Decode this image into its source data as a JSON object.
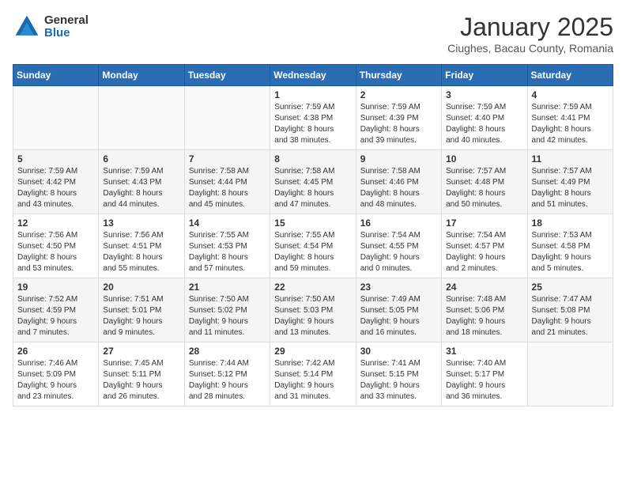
{
  "logo": {
    "general": "General",
    "blue": "Blue"
  },
  "title": "January 2025",
  "location": "Ciughes, Bacau County, Romania",
  "days_of_week": [
    "Sunday",
    "Monday",
    "Tuesday",
    "Wednesday",
    "Thursday",
    "Friday",
    "Saturday"
  ],
  "weeks": [
    [
      {
        "day": "",
        "info": ""
      },
      {
        "day": "",
        "info": ""
      },
      {
        "day": "",
        "info": ""
      },
      {
        "day": "1",
        "info": "Sunrise: 7:59 AM\nSunset: 4:38 PM\nDaylight: 8 hours\nand 38 minutes."
      },
      {
        "day": "2",
        "info": "Sunrise: 7:59 AM\nSunset: 4:39 PM\nDaylight: 8 hours\nand 39 minutes."
      },
      {
        "day": "3",
        "info": "Sunrise: 7:59 AM\nSunset: 4:40 PM\nDaylight: 8 hours\nand 40 minutes."
      },
      {
        "day": "4",
        "info": "Sunrise: 7:59 AM\nSunset: 4:41 PM\nDaylight: 8 hours\nand 42 minutes."
      }
    ],
    [
      {
        "day": "5",
        "info": "Sunrise: 7:59 AM\nSunset: 4:42 PM\nDaylight: 8 hours\nand 43 minutes."
      },
      {
        "day": "6",
        "info": "Sunrise: 7:59 AM\nSunset: 4:43 PM\nDaylight: 8 hours\nand 44 minutes."
      },
      {
        "day": "7",
        "info": "Sunrise: 7:58 AM\nSunset: 4:44 PM\nDaylight: 8 hours\nand 45 minutes."
      },
      {
        "day": "8",
        "info": "Sunrise: 7:58 AM\nSunset: 4:45 PM\nDaylight: 8 hours\nand 47 minutes."
      },
      {
        "day": "9",
        "info": "Sunrise: 7:58 AM\nSunset: 4:46 PM\nDaylight: 8 hours\nand 48 minutes."
      },
      {
        "day": "10",
        "info": "Sunrise: 7:57 AM\nSunset: 4:48 PM\nDaylight: 8 hours\nand 50 minutes."
      },
      {
        "day": "11",
        "info": "Sunrise: 7:57 AM\nSunset: 4:49 PM\nDaylight: 8 hours\nand 51 minutes."
      }
    ],
    [
      {
        "day": "12",
        "info": "Sunrise: 7:56 AM\nSunset: 4:50 PM\nDaylight: 8 hours\nand 53 minutes."
      },
      {
        "day": "13",
        "info": "Sunrise: 7:56 AM\nSunset: 4:51 PM\nDaylight: 8 hours\nand 55 minutes."
      },
      {
        "day": "14",
        "info": "Sunrise: 7:55 AM\nSunset: 4:53 PM\nDaylight: 8 hours\nand 57 minutes."
      },
      {
        "day": "15",
        "info": "Sunrise: 7:55 AM\nSunset: 4:54 PM\nDaylight: 8 hours\nand 59 minutes."
      },
      {
        "day": "16",
        "info": "Sunrise: 7:54 AM\nSunset: 4:55 PM\nDaylight: 9 hours\nand 0 minutes."
      },
      {
        "day": "17",
        "info": "Sunrise: 7:54 AM\nSunset: 4:57 PM\nDaylight: 9 hours\nand 2 minutes."
      },
      {
        "day": "18",
        "info": "Sunrise: 7:53 AM\nSunset: 4:58 PM\nDaylight: 9 hours\nand 5 minutes."
      }
    ],
    [
      {
        "day": "19",
        "info": "Sunrise: 7:52 AM\nSunset: 4:59 PM\nDaylight: 9 hours\nand 7 minutes."
      },
      {
        "day": "20",
        "info": "Sunrise: 7:51 AM\nSunset: 5:01 PM\nDaylight: 9 hours\nand 9 minutes."
      },
      {
        "day": "21",
        "info": "Sunrise: 7:50 AM\nSunset: 5:02 PM\nDaylight: 9 hours\nand 11 minutes."
      },
      {
        "day": "22",
        "info": "Sunrise: 7:50 AM\nSunset: 5:03 PM\nDaylight: 9 hours\nand 13 minutes."
      },
      {
        "day": "23",
        "info": "Sunrise: 7:49 AM\nSunset: 5:05 PM\nDaylight: 9 hours\nand 16 minutes."
      },
      {
        "day": "24",
        "info": "Sunrise: 7:48 AM\nSunset: 5:06 PM\nDaylight: 9 hours\nand 18 minutes."
      },
      {
        "day": "25",
        "info": "Sunrise: 7:47 AM\nSunset: 5:08 PM\nDaylight: 9 hours\nand 21 minutes."
      }
    ],
    [
      {
        "day": "26",
        "info": "Sunrise: 7:46 AM\nSunset: 5:09 PM\nDaylight: 9 hours\nand 23 minutes."
      },
      {
        "day": "27",
        "info": "Sunrise: 7:45 AM\nSunset: 5:11 PM\nDaylight: 9 hours\nand 26 minutes."
      },
      {
        "day": "28",
        "info": "Sunrise: 7:44 AM\nSunset: 5:12 PM\nDaylight: 9 hours\nand 28 minutes."
      },
      {
        "day": "29",
        "info": "Sunrise: 7:42 AM\nSunset: 5:14 PM\nDaylight: 9 hours\nand 31 minutes."
      },
      {
        "day": "30",
        "info": "Sunrise: 7:41 AM\nSunset: 5:15 PM\nDaylight: 9 hours\nand 33 minutes."
      },
      {
        "day": "31",
        "info": "Sunrise: 7:40 AM\nSunset: 5:17 PM\nDaylight: 9 hours\nand 36 minutes."
      },
      {
        "day": "",
        "info": ""
      }
    ]
  ]
}
